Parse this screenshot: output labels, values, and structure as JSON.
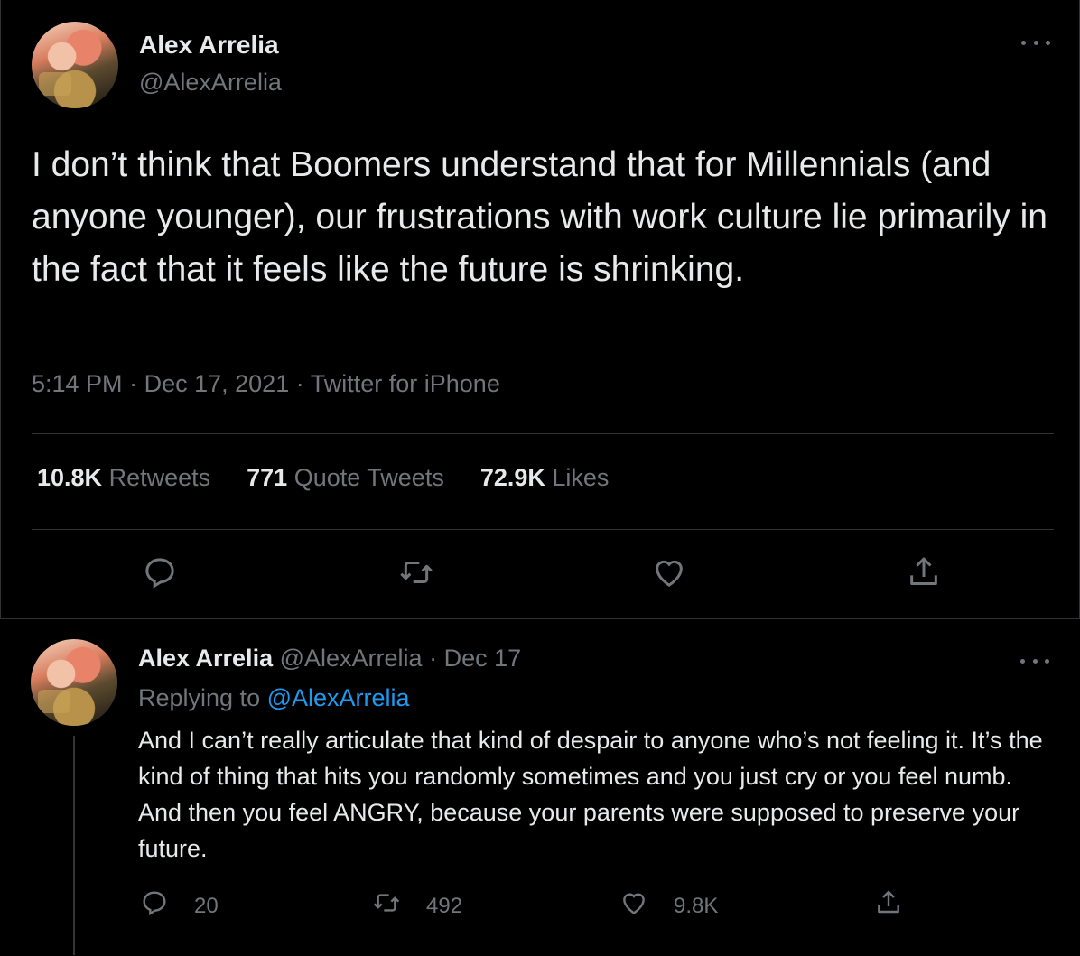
{
  "main_tweet": {
    "author_name": "Alex Arrelia",
    "author_handle": "@AlexArrelia",
    "text": "I don’t think that Boomers understand that for Millennials (and anyone younger), our frustrations with work culture lie primarily in the fact that it feels like the future is shrinking.",
    "time": "5:14 PM",
    "separator": "·",
    "date": "Dec 17, 2021",
    "source": "Twitter for iPhone",
    "stats": {
      "retweets_count": "10.8K",
      "retweets_label": "Retweets",
      "quotes_count": "771",
      "quotes_label": "Quote Tweets",
      "likes_count": "72.9K",
      "likes_label": "Likes"
    },
    "icons": [
      "reply-icon",
      "retweet-icon",
      "like-icon",
      "share-icon"
    ]
  },
  "reply_tweet": {
    "author_name": "Alex Arrelia",
    "author_handle": "@AlexArrelia",
    "separator": "·",
    "date": "Dec 17",
    "replying_prefix": "Replying to",
    "replying_handle": "@AlexArrelia",
    "text": "And I can’t really articulate that kind of despair to anyone who’s not feeling it. It’s the kind of thing that hits you randomly sometimes and you just cry or you feel numb. And then you feel ANGRY, because your parents were supposed to preserve your future.",
    "reply_count": "20",
    "retweet_count": "492",
    "like_count": "9.8K"
  },
  "colors": {
    "background": "#000000",
    "text": "#e7e9ea",
    "muted": "#71767b",
    "link": "#1d9bf0",
    "divider": "#2f3336"
  }
}
